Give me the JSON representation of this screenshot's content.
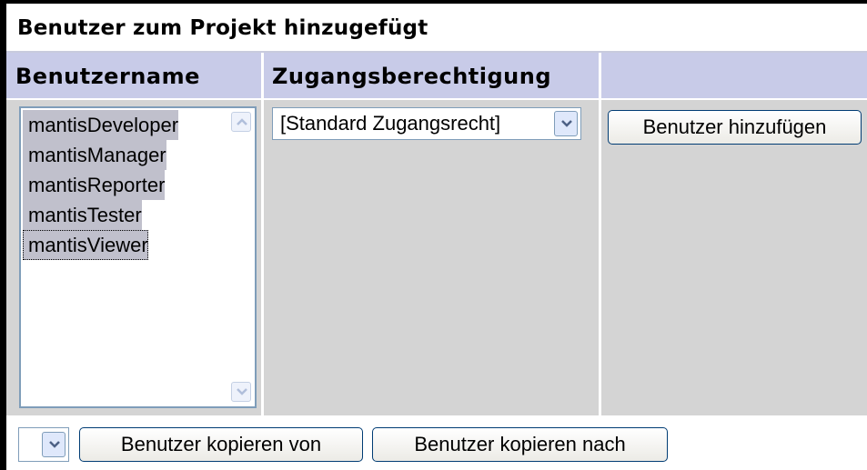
{
  "panel": {
    "title": "Benutzer zum Projekt hinzugefügt"
  },
  "columns": {
    "username": "Benutzername",
    "access": "Zugangsberechtigung",
    "actions": ""
  },
  "user_list": {
    "items": [
      {
        "label": "mantisDeveloper",
        "selected": true
      },
      {
        "label": "mantisManager",
        "selected": true
      },
      {
        "label": "mantisReporter",
        "selected": true
      },
      {
        "label": "mantisTester",
        "selected": true
      },
      {
        "label": "mantisViewer",
        "selected": true,
        "focused": true
      }
    ]
  },
  "access_select": {
    "value": "[Standard Zugangsrecht]"
  },
  "buttons": {
    "add_user": "Benutzer hinzufügen",
    "copy_from": "Benutzer kopieren von",
    "copy_to": "Benutzer kopieren nach"
  },
  "project_select": {
    "value": ""
  },
  "colors": {
    "header_bg": "#c8cbe8",
    "body_bg": "#d4d4d4",
    "selection_bg": "#c0c0cc",
    "button_border": "#003c74"
  }
}
